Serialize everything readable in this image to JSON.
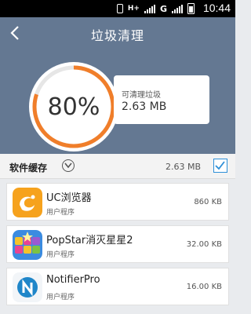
{
  "status_bar": {
    "network_label": "H+",
    "carrier_label": "G",
    "time": "10:44",
    "icons": [
      "vibrate-icon",
      "signal-icon",
      "signal-icon",
      "battery-icon"
    ]
  },
  "header": {
    "title": "垃圾清理",
    "back_icon": "back-arrow-icon"
  },
  "summary": {
    "percent_text": "80%",
    "percent_value": 0.8,
    "label": "可清理垃圾",
    "size": "2.63 MB",
    "accent_color": "#f07e2a"
  },
  "section": {
    "title": "软件缓存",
    "size": "2.63 MB",
    "checked": true,
    "toggle_icon": "chevron-down-icon"
  },
  "apps": [
    {
      "name": "UC浏览器",
      "type": "用户程序",
      "size": "860 KB",
      "icon": "uc-browser-icon"
    },
    {
      "name": "PopStar消灭星星2",
      "type": "用户程序",
      "size": "32.00 KB",
      "icon": "popstar-icon"
    },
    {
      "name": "NotifierPro",
      "type": "用户程序",
      "size": "16.00 KB",
      "icon": "notifierpro-icon"
    }
  ]
}
